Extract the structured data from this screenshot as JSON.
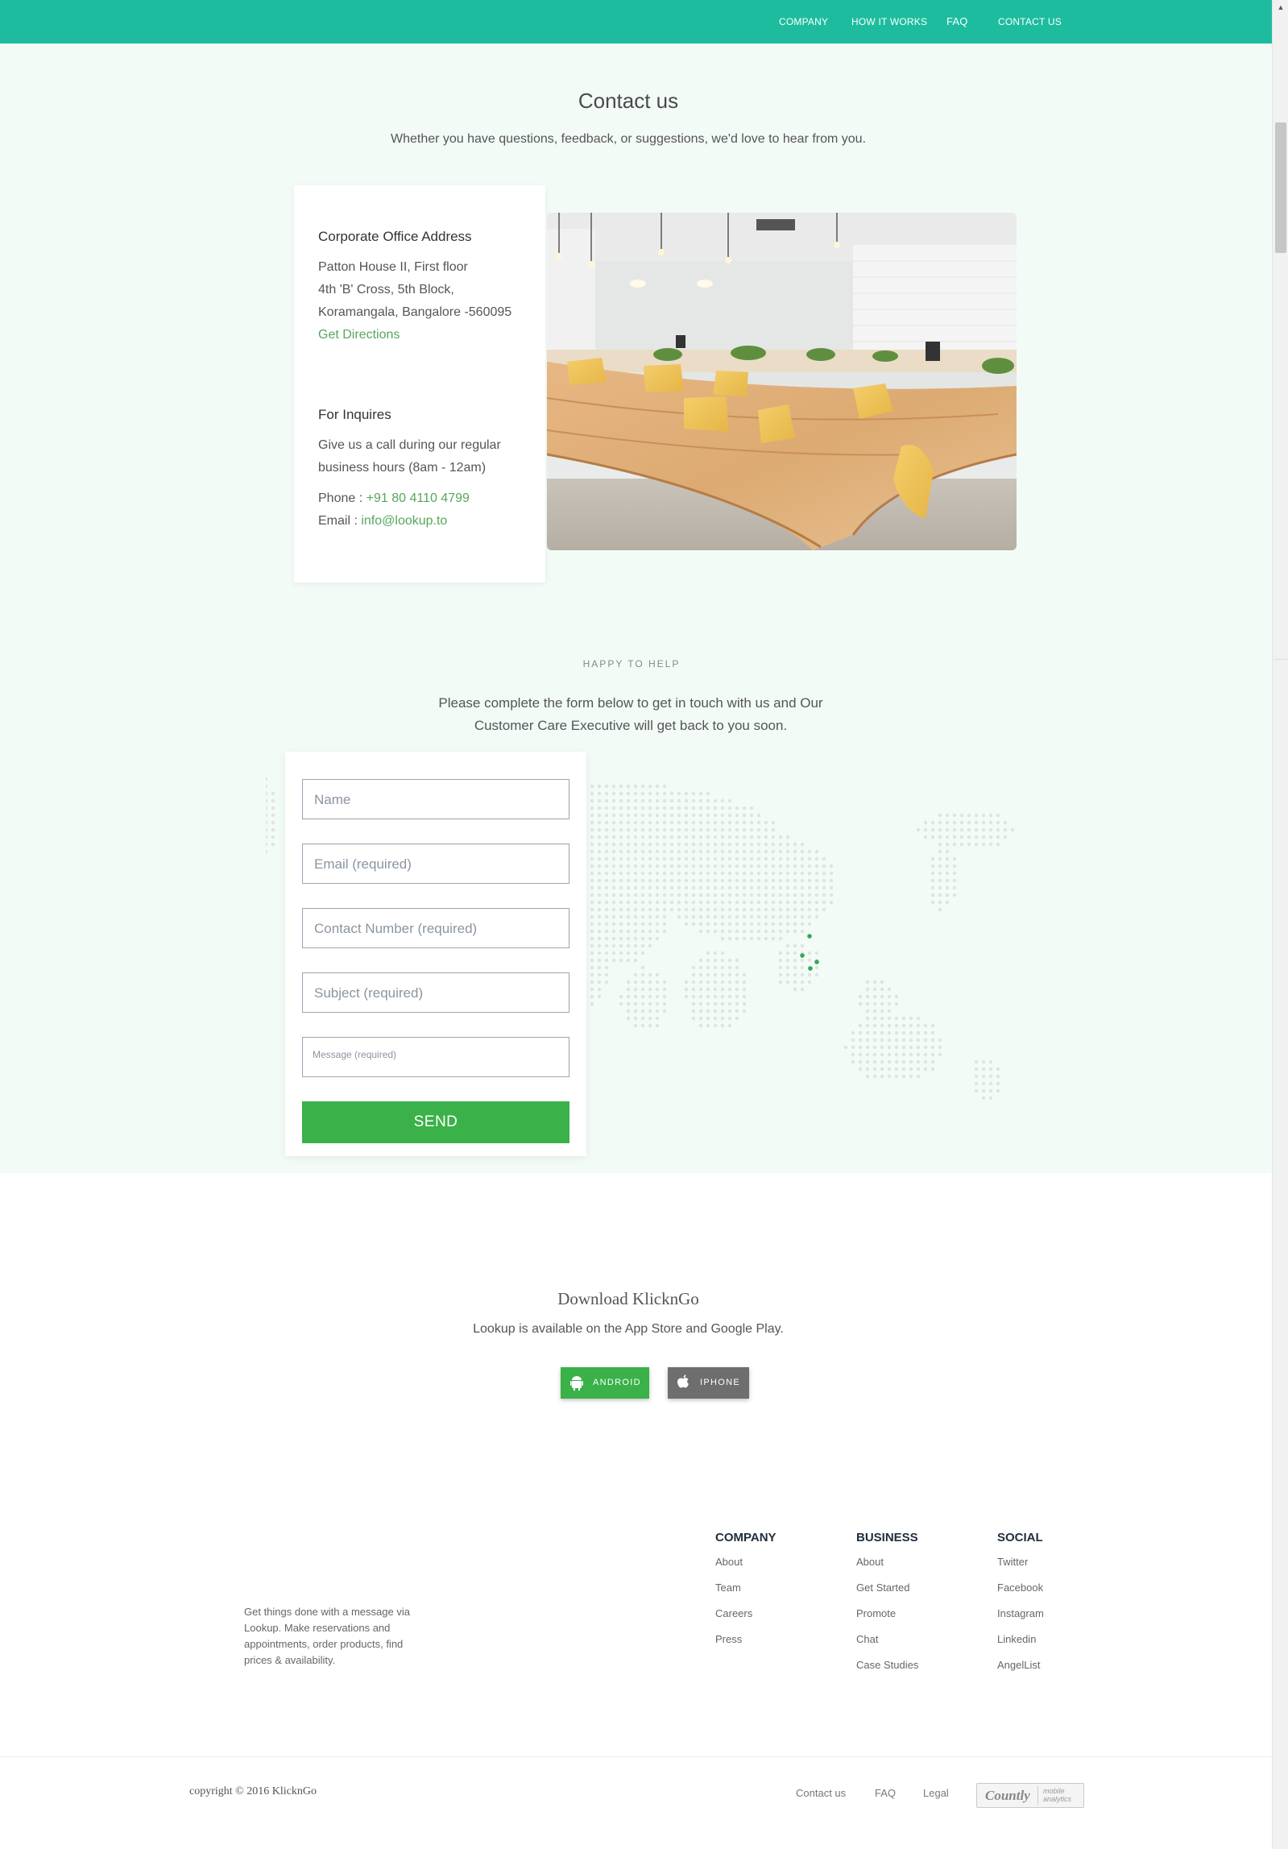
{
  "header": {
    "nav": [
      "COMPANY",
      "HOW IT WORKS",
      "FAQ",
      "CONTACT US"
    ],
    "bg_color": "#1dbc9f"
  },
  "contact": {
    "title": "Contact us",
    "subtitle": "Whether you have questions, feedback, or suggestions, we'd love to hear from you.",
    "office_heading": "Corporate Office Address",
    "address": [
      "Patton House II, First floor",
      "4th 'B' Cross, 5th Block,",
      "Koramangala, Bangalore -560095"
    ],
    "directions_link": "Get Directions",
    "inquiries_heading": "For Inquires",
    "inquiries_text": [
      "Give us a call during our regular",
      "business hours (8am - 12am)"
    ],
    "phone_label": "Phone : ",
    "phone": "+91 80 4110 4799",
    "email_label": "Email : ",
    "email": "info@lookup.to"
  },
  "help": {
    "label": "HAPPY TO HELP",
    "text": [
      "Please complete the form below to get in touch with us and Our",
      "Customer Care Executive will get back to you soon."
    ]
  },
  "form": {
    "name_placeholder": "Name",
    "email_placeholder": "Email (required)",
    "contact_placeholder": "Contact Number (required)",
    "subject_placeholder": "Subject (required)",
    "message_placeholder": "Message (required)",
    "send_label": "SEND",
    "accent_color": "#3ab149"
  },
  "download": {
    "title": "Download KlicknGo",
    "subtitle": "Lookup is available on the App Store and Google Play.",
    "android_label": "ANDROID",
    "iphone_label": "IPHONE",
    "android_icon": "android-icon",
    "iphone_icon": "apple-icon"
  },
  "footer": {
    "description": "Get things done with a message via Lookup. Make reservations and appointments, order products, find prices & availability.",
    "columns": [
      {
        "heading": "COMPANY",
        "links": [
          "About",
          "Team",
          "Careers",
          "Press"
        ]
      },
      {
        "heading": "BUSINESS",
        "links": [
          "About",
          "Get Started",
          "Promote",
          "Chat",
          "Case Studies"
        ]
      },
      {
        "heading": "SOCIAL",
        "links": [
          "Twitter",
          "Facebook",
          "Instagram",
          "Linkedin",
          "AngelList"
        ]
      }
    ],
    "copyright": "copyright © 2016  KlicknGo",
    "bottom_links": [
      "Contact us",
      "FAQ",
      "Legal"
    ],
    "countly_brand": "Countly",
    "countly_tag": [
      "mobile",
      "analytics"
    ]
  }
}
